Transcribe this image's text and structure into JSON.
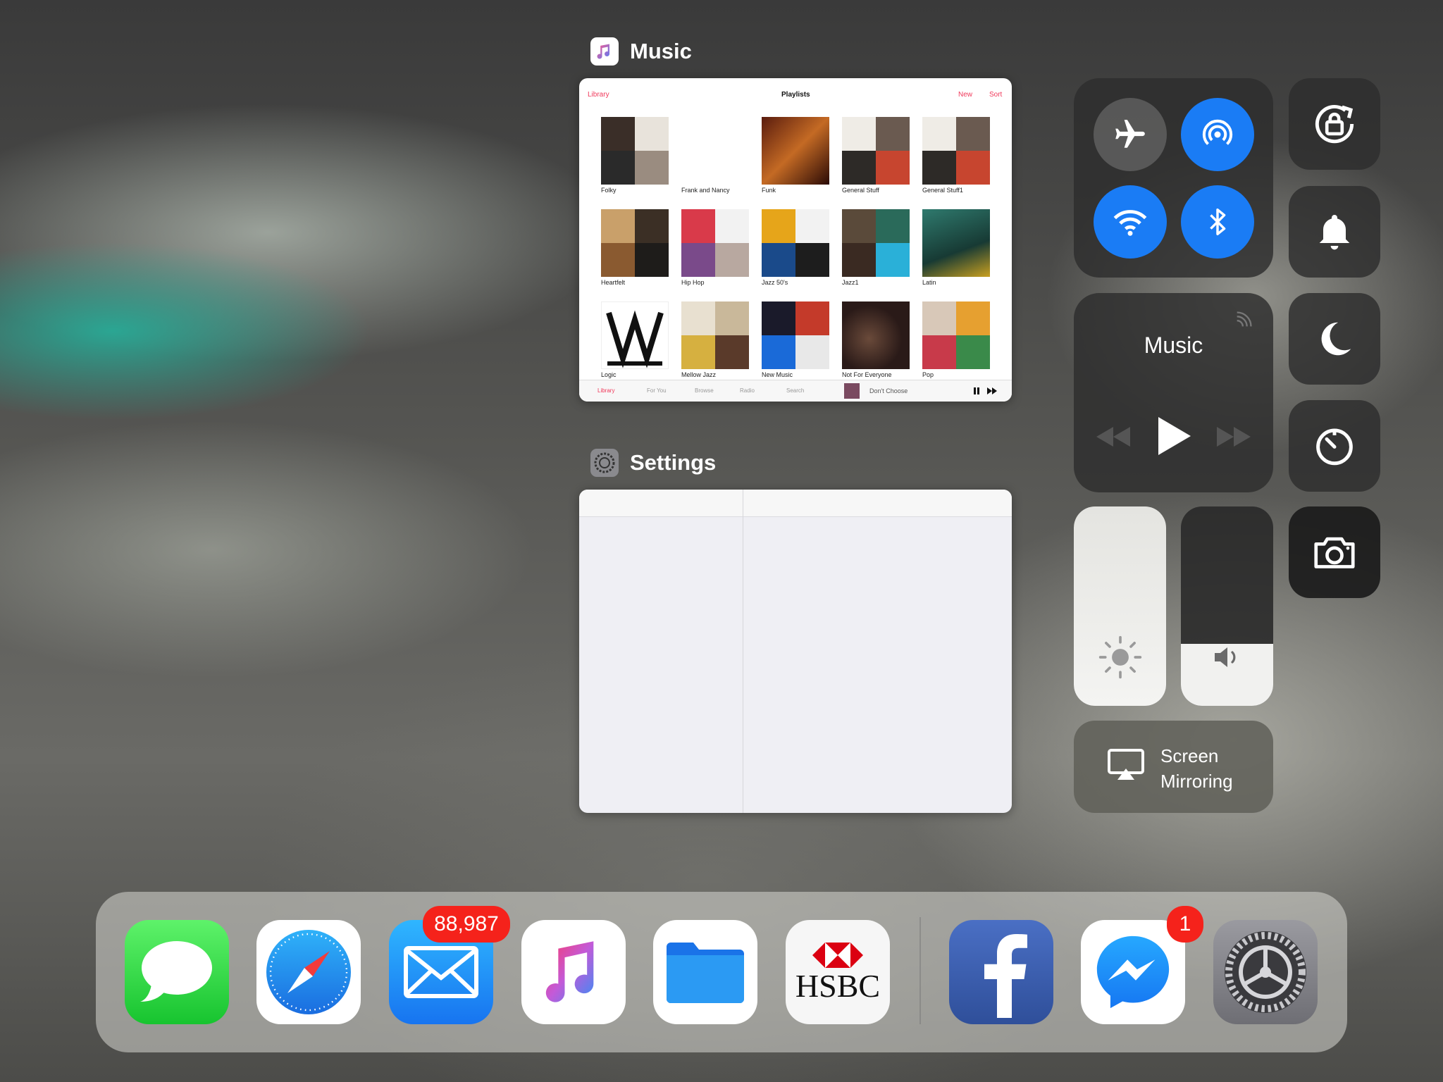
{
  "switcher": {
    "music_app_title": "Music",
    "settings_app_title": "Settings"
  },
  "music_preview": {
    "nav_back": "Library",
    "nav_title": "Playlists",
    "nav_new": "New",
    "nav_sort": "Sort",
    "playlists": [
      "Folky",
      "Frank and Nancy",
      "Funk",
      "General Stuff",
      "General Stuff1",
      "Heartfelt",
      "Hip Hop",
      "Jazz 50's",
      "Jazz1",
      "Latin",
      "Logic",
      "Mellow Jazz",
      "New Music",
      "Not For Everyone",
      "Pop"
    ],
    "tabs": [
      "Library",
      "For You",
      "Browse",
      "Radio",
      "Search"
    ],
    "now_playing": "Don't Choose"
  },
  "control_center": {
    "now_playing_title": "Music",
    "screen_mirroring_line1": "Screen",
    "screen_mirroring_line2": "Mirroring",
    "brightness_level": 1.0,
    "volume_level": 0.31,
    "colors": {
      "accent": "#1a7cf5",
      "tile": "#2d2d2d"
    }
  },
  "dock": {
    "mail_badge": "88,987",
    "messenger_badge": "1",
    "hsbc_label": "HSBC",
    "apps": [
      "messages-icon",
      "safari-icon",
      "mail-icon",
      "music-icon",
      "files-icon",
      "hsbc-icon",
      "facebook-icon",
      "messenger-icon",
      "settings-icon"
    ]
  }
}
